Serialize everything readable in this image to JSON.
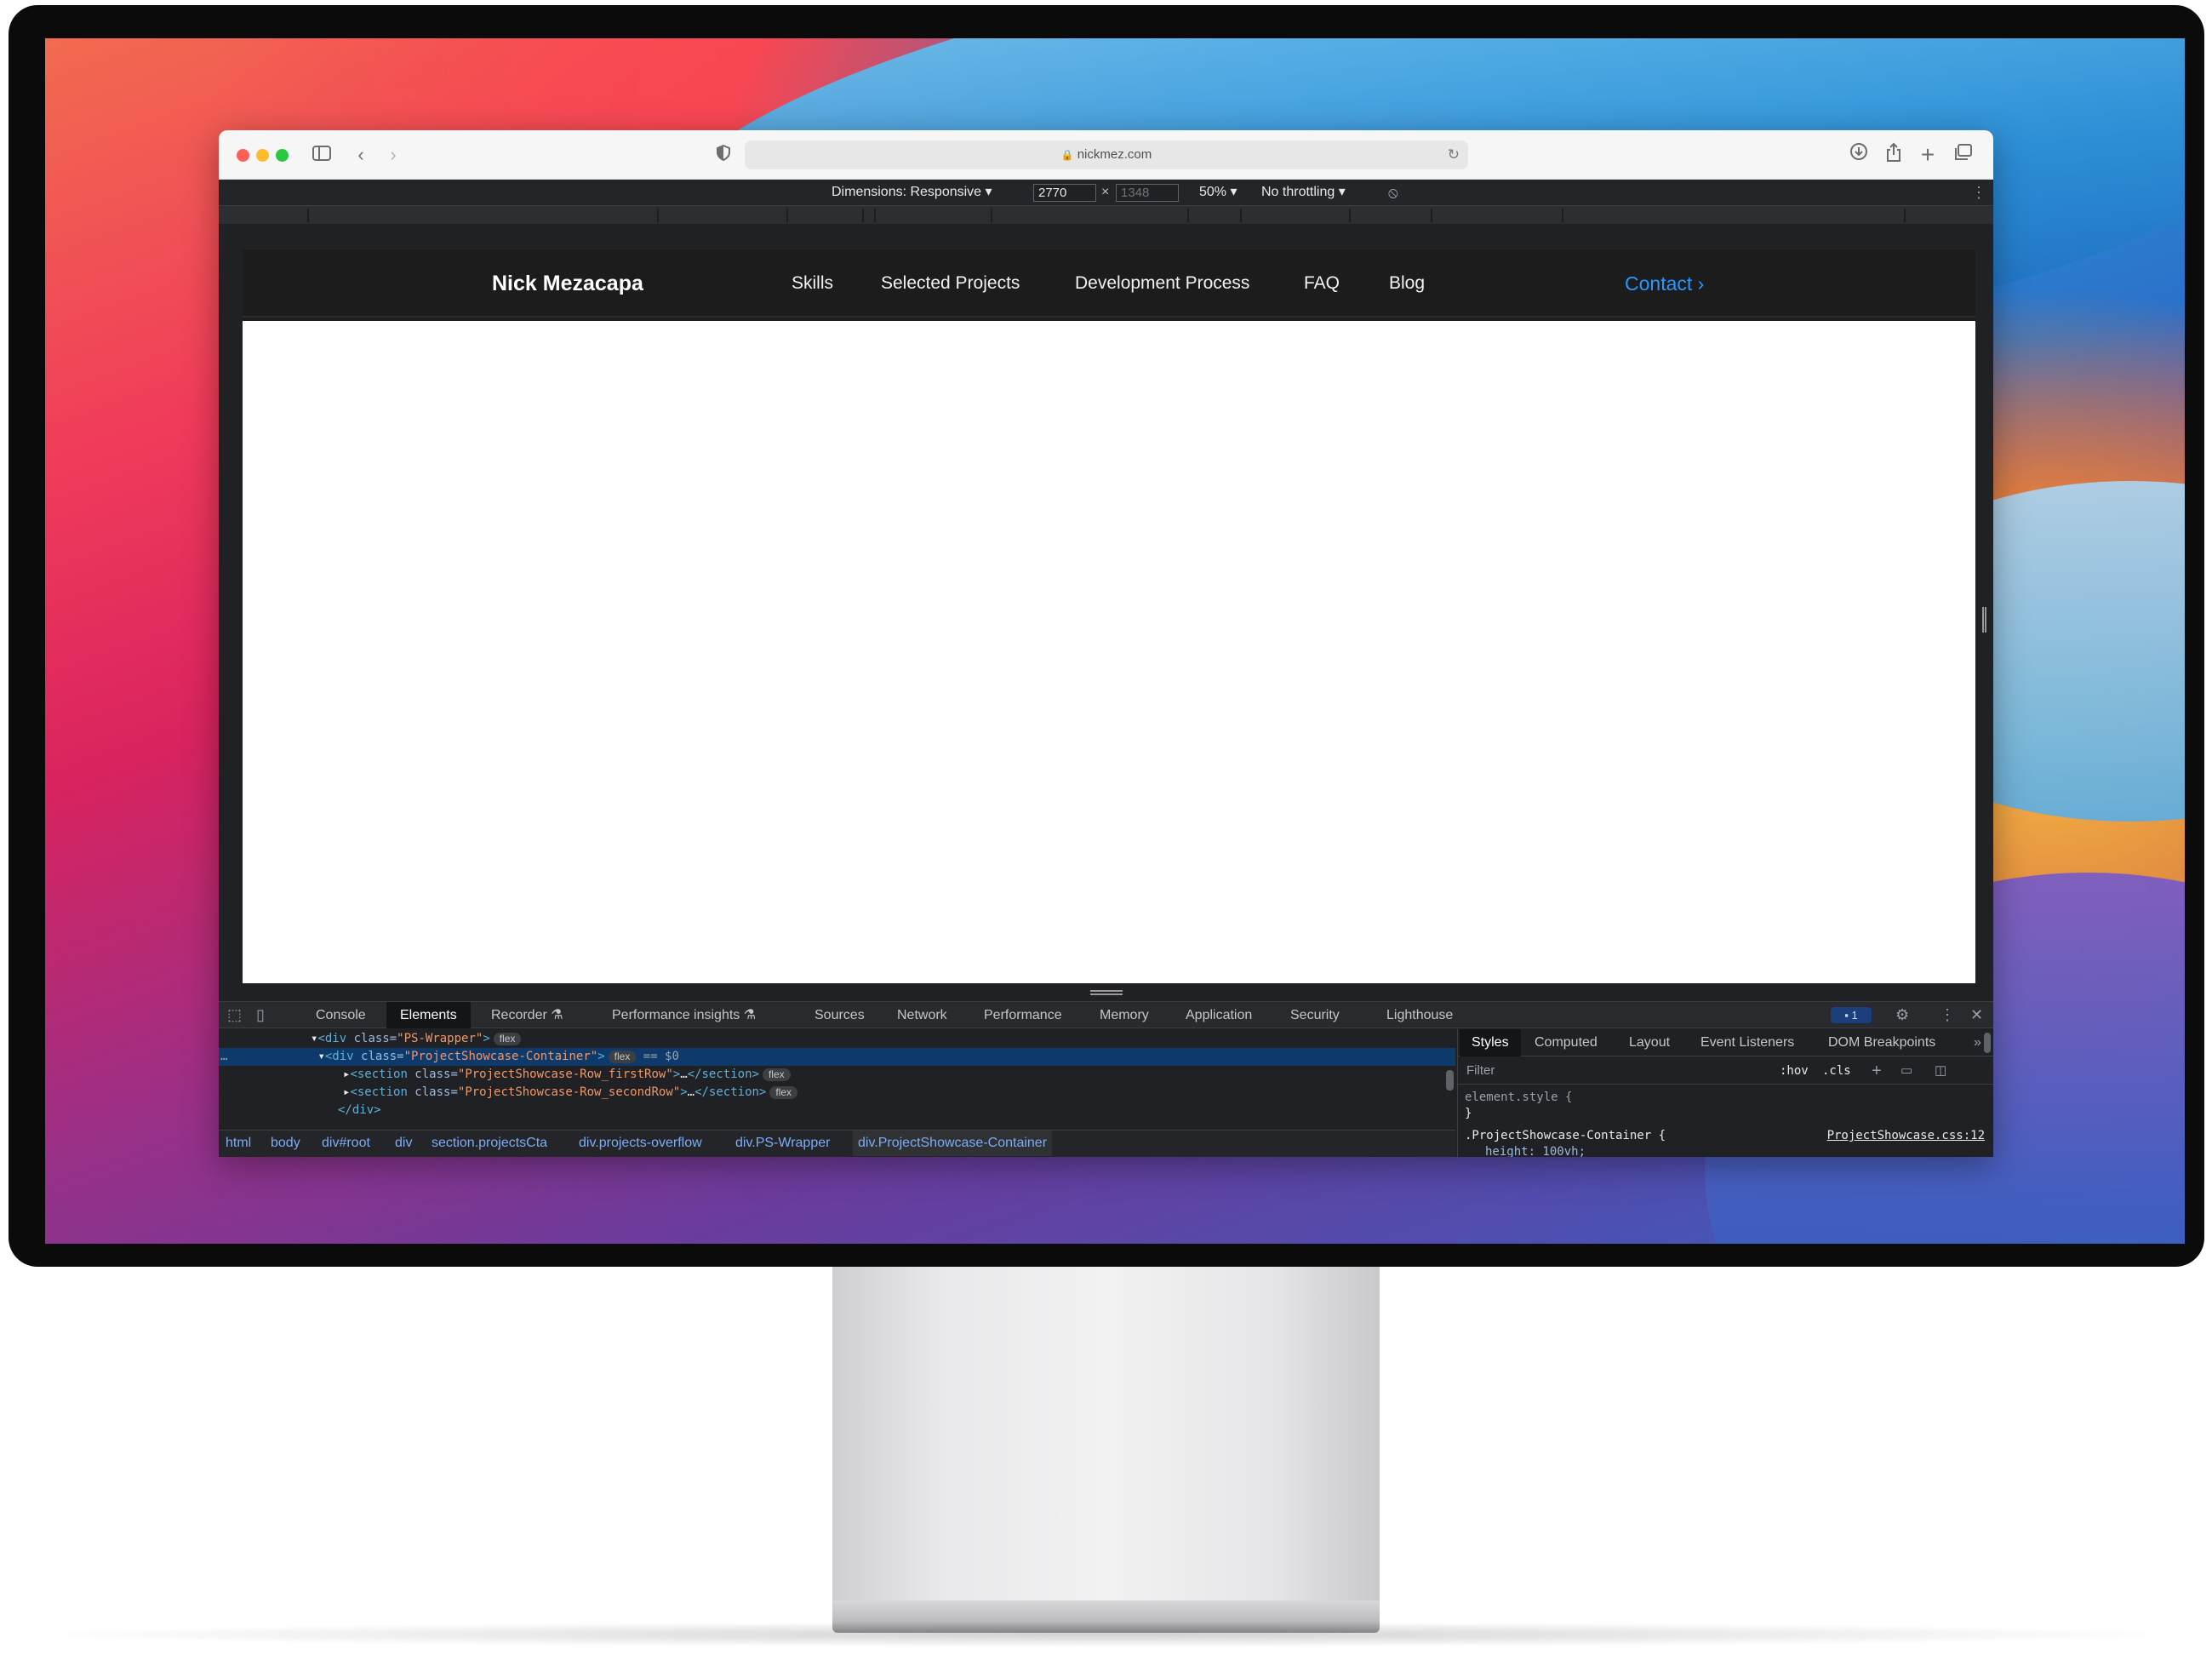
{
  "browser": {
    "url": "nickmez.com",
    "toolbar_icons": [
      "sidebar-icon",
      "back-icon",
      "forward-icon",
      "shield-icon",
      "download-icon",
      "share-icon",
      "new-tab-icon",
      "tabs-overview-icon"
    ]
  },
  "device_toolbar": {
    "dimensions": "Dimensions: Responsive",
    "width_value": "2770",
    "height_placeholder": "1348",
    "zoom": "50%",
    "throttling": "No throttling"
  },
  "site": {
    "brand": "Nick Mezacapa",
    "nav": [
      "Skills",
      "Selected Projects",
      "Development Process",
      "FAQ",
      "Blog"
    ],
    "contact": "Contact",
    "contact_color": "#2997ff"
  },
  "devtools": {
    "tabs": [
      "Console",
      "Elements",
      "Recorder",
      "Performance insights",
      "Sources",
      "Network",
      "Performance",
      "Memory",
      "Application",
      "Security",
      "Lighthouse"
    ],
    "active_tab": "Elements",
    "issues_count": "1",
    "dom": {
      "line1_class": "PS-Wrapper",
      "line2_class": "ProjectShowcase-Container",
      "line2_ref": "== $0",
      "line3_class": "ProjectShowcase-Row_firstRow",
      "line4_class": "ProjectShowcase-Row_secondRow",
      "line5": "</div>",
      "pill": "flex"
    },
    "breadcrumbs": [
      "html",
      "body",
      "div#root",
      "div",
      "section.projectsCta",
      "div.projects-overflow",
      "div.PS-Wrapper",
      "div.ProjectShowcase-Container"
    ],
    "styles_tabs": [
      "Styles",
      "Computed",
      "Layout",
      "Event Listeners",
      "DOM Breakpoints"
    ],
    "filter_placeholder": "Filter",
    "hov": ":hov",
    "cls": ".cls",
    "element_style": "element.style {",
    "close_brace": "}",
    "rule_selector": ".ProjectShowcase-Container {",
    "rule_source": "ProjectShowcase.css:12",
    "rule_prop": "height: 100vh;"
  }
}
